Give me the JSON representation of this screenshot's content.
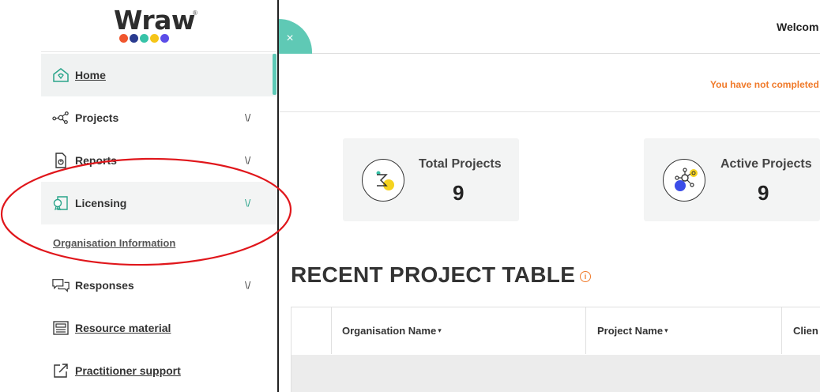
{
  "logo": {
    "text": "Wraw",
    "reg": "®",
    "dots": [
      "#f0562e",
      "#2a3b8f",
      "#37c3a8",
      "#f5c518",
      "#5b4de8"
    ]
  },
  "sidebar": {
    "items": [
      {
        "label": "Home",
        "icon": "home-icon",
        "chevron": ""
      },
      {
        "label": "Projects",
        "icon": "network-icon",
        "chevron": "\\/"
      },
      {
        "label": "Reports",
        "icon": "report-icon",
        "chevron": "\\/"
      },
      {
        "label": "Licensing",
        "icon": "license-icon",
        "chevron": "\\/"
      },
      {
        "label": "Responses",
        "icon": "chat-icon",
        "chevron": "\\/"
      },
      {
        "label": "Resource material",
        "icon": "book-icon",
        "chevron": ""
      },
      {
        "label": "Practitioner support",
        "icon": "external-link-icon",
        "chevron": ""
      }
    ],
    "sub_item": "Organisation Information"
  },
  "header": {
    "close_glyph": "×",
    "welcome": "Welcom"
  },
  "notice": "You have not completed",
  "cards": [
    {
      "title": "Total Projects",
      "value": "9"
    },
    {
      "title": "Active Projects",
      "value": "9"
    }
  ],
  "section": {
    "title": "RECENT PROJECT TABLE",
    "info_glyph": "i"
  },
  "table": {
    "columns": [
      "",
      "Organisation Name",
      "Project Name",
      "Clien"
    ],
    "sort_glyph": "▾"
  },
  "colors": {
    "accent": "#5fc9b5",
    "warning": "#f07a2a",
    "annotation": "#e0161b"
  }
}
